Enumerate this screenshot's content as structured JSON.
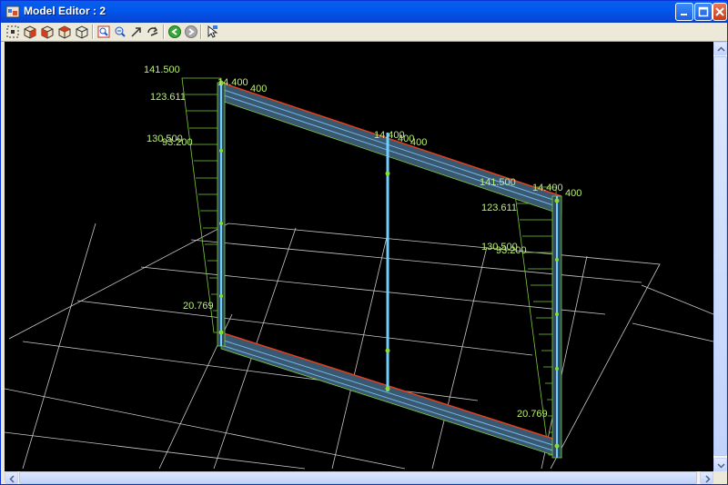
{
  "window": {
    "title": "Model Editor : 2",
    "icon": "model-editor-app-icon",
    "controls": [
      "minimize-icon",
      "maximize-icon",
      "close-icon"
    ]
  },
  "toolbar": {
    "buttons": [
      "fit-view-icon",
      "iso-view-icon",
      "front-view-icon",
      "side-view-icon",
      "wireframe-view-icon",
      "zoom-window-icon",
      "zoom-out-icon",
      "pan-icon",
      "rotate-icon",
      "back-icon",
      "forward-icon",
      "select-pointer-icon"
    ]
  },
  "model": {
    "labels": {
      "left_top": "141.500",
      "left_upper": "123.611",
      "left_mid_a": "130.500",
      "left_mid_b": "93.200",
      "left_bottom": "20.769",
      "top_left_a": "14.400",
      "top_left_b": "400",
      "top_mid_a": "14.400",
      "top_mid_b": "400",
      "top_mid_c": "400",
      "right_top": "141.500",
      "right_top_a": "14.400",
      "right_top_b": "400",
      "right_upper": "123.611",
      "right_mid_a": "130.500",
      "right_mid_b": "93.200",
      "right_bottom": "20.769"
    }
  }
}
